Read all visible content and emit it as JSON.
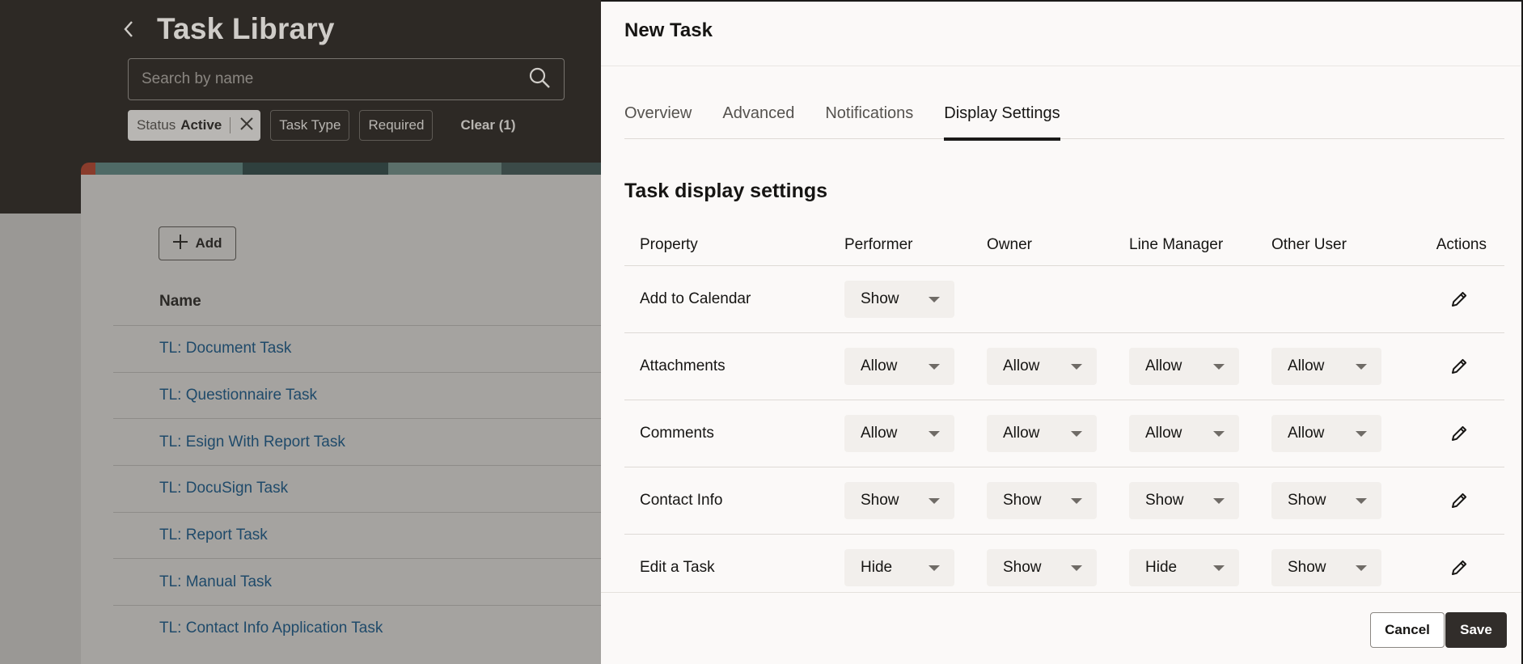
{
  "background": {
    "title": "Task Library",
    "search": {
      "placeholder": "Search by name"
    },
    "filters": {
      "status_label": "Status",
      "status_value": "Active",
      "task_type": "Task Type",
      "required": "Required",
      "clear": "Clear (1)"
    },
    "add_label": "Add",
    "column_header": "Name",
    "tasks": [
      "TL: Document Task",
      "TL: Questionnaire Task",
      "TL: Esign With Report Task",
      "TL: DocuSign Task",
      "TL: Report Task",
      "TL: Manual Task",
      "TL: Contact Info Application Task"
    ]
  },
  "drawer": {
    "title": "New Task",
    "tabs": [
      "Overview",
      "Advanced",
      "Notifications",
      "Display Settings"
    ],
    "selected_tab": "Display Settings",
    "section_title": "Task display settings",
    "columns": {
      "property": "Property",
      "performer": "Performer",
      "owner": "Owner",
      "line_manager": "Line Manager",
      "other_user": "Other User",
      "actions": "Actions"
    },
    "rows": [
      {
        "property": "Add to Calendar",
        "performer": "Show",
        "owner": "",
        "line_manager": "",
        "other_user": ""
      },
      {
        "property": "Attachments",
        "performer": "Allow",
        "owner": "Allow",
        "line_manager": "Allow",
        "other_user": "Allow"
      },
      {
        "property": "Comments",
        "performer": "Allow",
        "owner": "Allow",
        "line_manager": "Allow",
        "other_user": "Allow"
      },
      {
        "property": "Contact Info",
        "performer": "Show",
        "owner": "Show",
        "line_manager": "Show",
        "other_user": "Show"
      },
      {
        "property": "Edit a Task",
        "performer": "Hide",
        "owner": "Show",
        "line_manager": "Hide",
        "other_user": "Show"
      }
    ],
    "footer": {
      "cancel": "Cancel",
      "save": "Save"
    }
  },
  "icons": {
    "back": "chevron-left-icon",
    "search": "search-icon",
    "close": "close-icon",
    "add": "plus-icon",
    "edit": "pencil-icon",
    "dropdown": "caret-down-icon"
  }
}
